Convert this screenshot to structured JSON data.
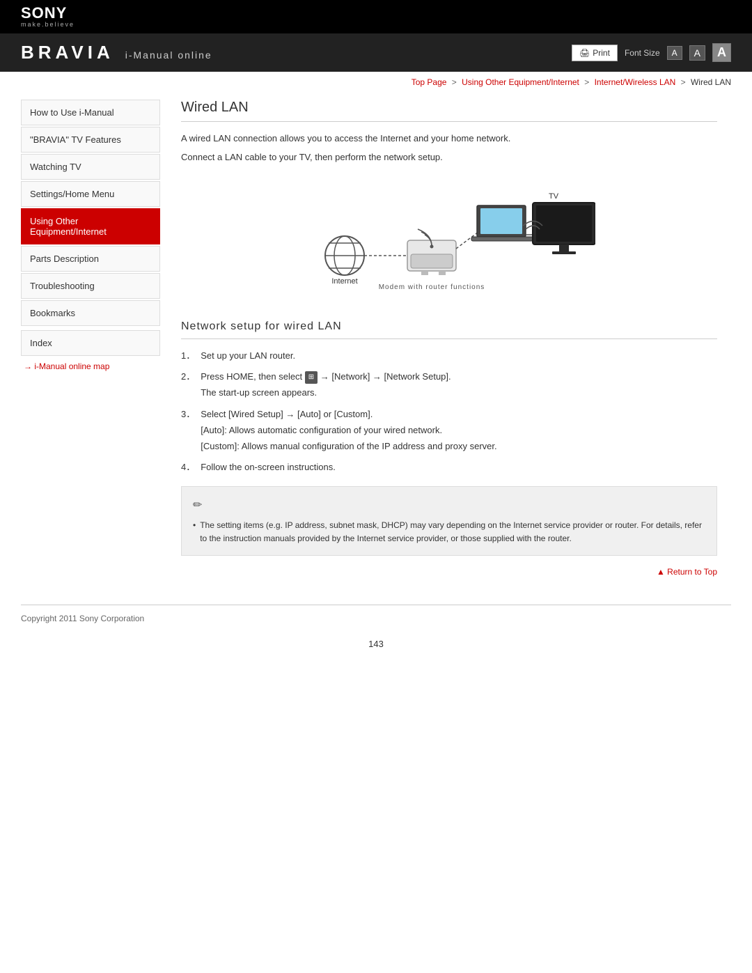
{
  "header": {
    "sony_logo": "SONY",
    "sony_tagline": "make.believe",
    "bravia_logo": "BRAVIA",
    "bravia_subtitle": "i-Manual online",
    "print_label": "Print",
    "font_size_label": "Font Size",
    "font_small": "A",
    "font_medium": "A",
    "font_large": "A"
  },
  "breadcrumb": {
    "top_page": "Top Page",
    "step2": "Using Other Equipment/Internet",
    "step3": "Internet/Wireless LAN",
    "current": "Wired LAN"
  },
  "sidebar": {
    "items": [
      {
        "label": "How to Use i-Manual",
        "active": false
      },
      {
        "label": "\"BRAVIA\" TV Features",
        "active": false
      },
      {
        "label": "Watching TV",
        "active": false
      },
      {
        "label": "Settings/Home Menu",
        "active": false
      },
      {
        "label": "Using Other Equipment/Internet",
        "active": true
      },
      {
        "label": "Parts Description",
        "active": false
      },
      {
        "label": "Troubleshooting",
        "active": false
      },
      {
        "label": "Bookmarks",
        "active": false
      }
    ],
    "index_label": "Index",
    "map_link": "→ i-Manual online map"
  },
  "content": {
    "page_title": "Wired LAN",
    "intro1": "A wired LAN connection allows you to access the Internet and your home network.",
    "intro2": "Connect a LAN cable to your TV, then perform the network setup.",
    "diagram": {
      "internet_label": "Internet",
      "modem_label": "Modem with router functions",
      "tv_label": "TV"
    },
    "section_title": "Network setup for wired LAN",
    "steps": [
      {
        "num": "1．",
        "text": "Set up your LAN router.",
        "sub": ""
      },
      {
        "num": "2．",
        "text": "Press HOME, then select  → [Network] → [Network Setup].",
        "sub": "The start-up screen appears."
      },
      {
        "num": "3．",
        "text": "Select [Wired Setup] → [Auto] or [Custom].",
        "sub1": "[Auto]: Allows automatic configuration of your wired network.",
        "sub2": "[Custom]: Allows manual configuration of the IP address and proxy server."
      },
      {
        "num": "4．",
        "text": "Follow the on-screen instructions.",
        "sub": ""
      }
    ],
    "note": {
      "bullet": "The setting items (e.g. IP address, subnet mask, DHCP) may vary depending on the Internet service provider or router. For details, refer to the instruction manuals provided by the Internet service provider, or those supplied with the router."
    },
    "return_top": "▲ Return to Top"
  },
  "footer": {
    "copyright": "Copyright 2011 Sony Corporation",
    "page_number": "143"
  }
}
